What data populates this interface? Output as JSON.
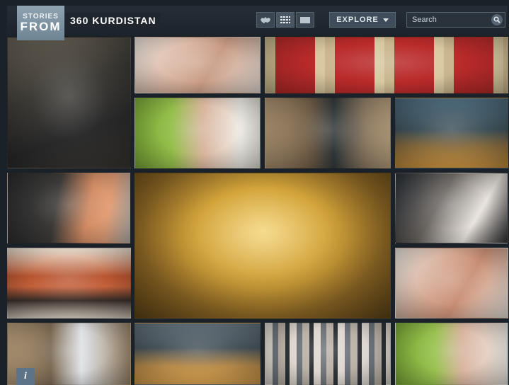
{
  "header": {
    "logo_top": "STORIES",
    "logo_bottom": "FROM",
    "site_title": "360 KURDISTAN",
    "explore_label": "EXPLORE",
    "search_placeholder": "Search"
  },
  "view_buttons": [
    {
      "icon": "map-icon"
    },
    {
      "icon": "grid-icon"
    },
    {
      "icon": "list-icon"
    }
  ],
  "info_label": "i",
  "tiles": [
    {
      "name": "photo-tile-elder-man"
    },
    {
      "name": "photo-tile-hands-1"
    },
    {
      "name": "photo-tile-rug"
    },
    {
      "name": "photo-tile-woman-headscarf-1"
    },
    {
      "name": "photo-tile-shop-man-1"
    },
    {
      "name": "photo-tile-pastry-vendor"
    },
    {
      "name": "photo-tile-girl-headscarf"
    },
    {
      "name": "photo-tile-gold-merchant"
    },
    {
      "name": "photo-tile-blessing"
    },
    {
      "name": "photo-tile-jars-vendor"
    },
    {
      "name": "photo-tile-hands-2"
    },
    {
      "name": "photo-tile-shop-man-2"
    },
    {
      "name": "photo-tile-market-vendor"
    },
    {
      "name": "photo-tile-fabric-shop"
    },
    {
      "name": "photo-tile-woman-headscarf-2"
    }
  ]
}
